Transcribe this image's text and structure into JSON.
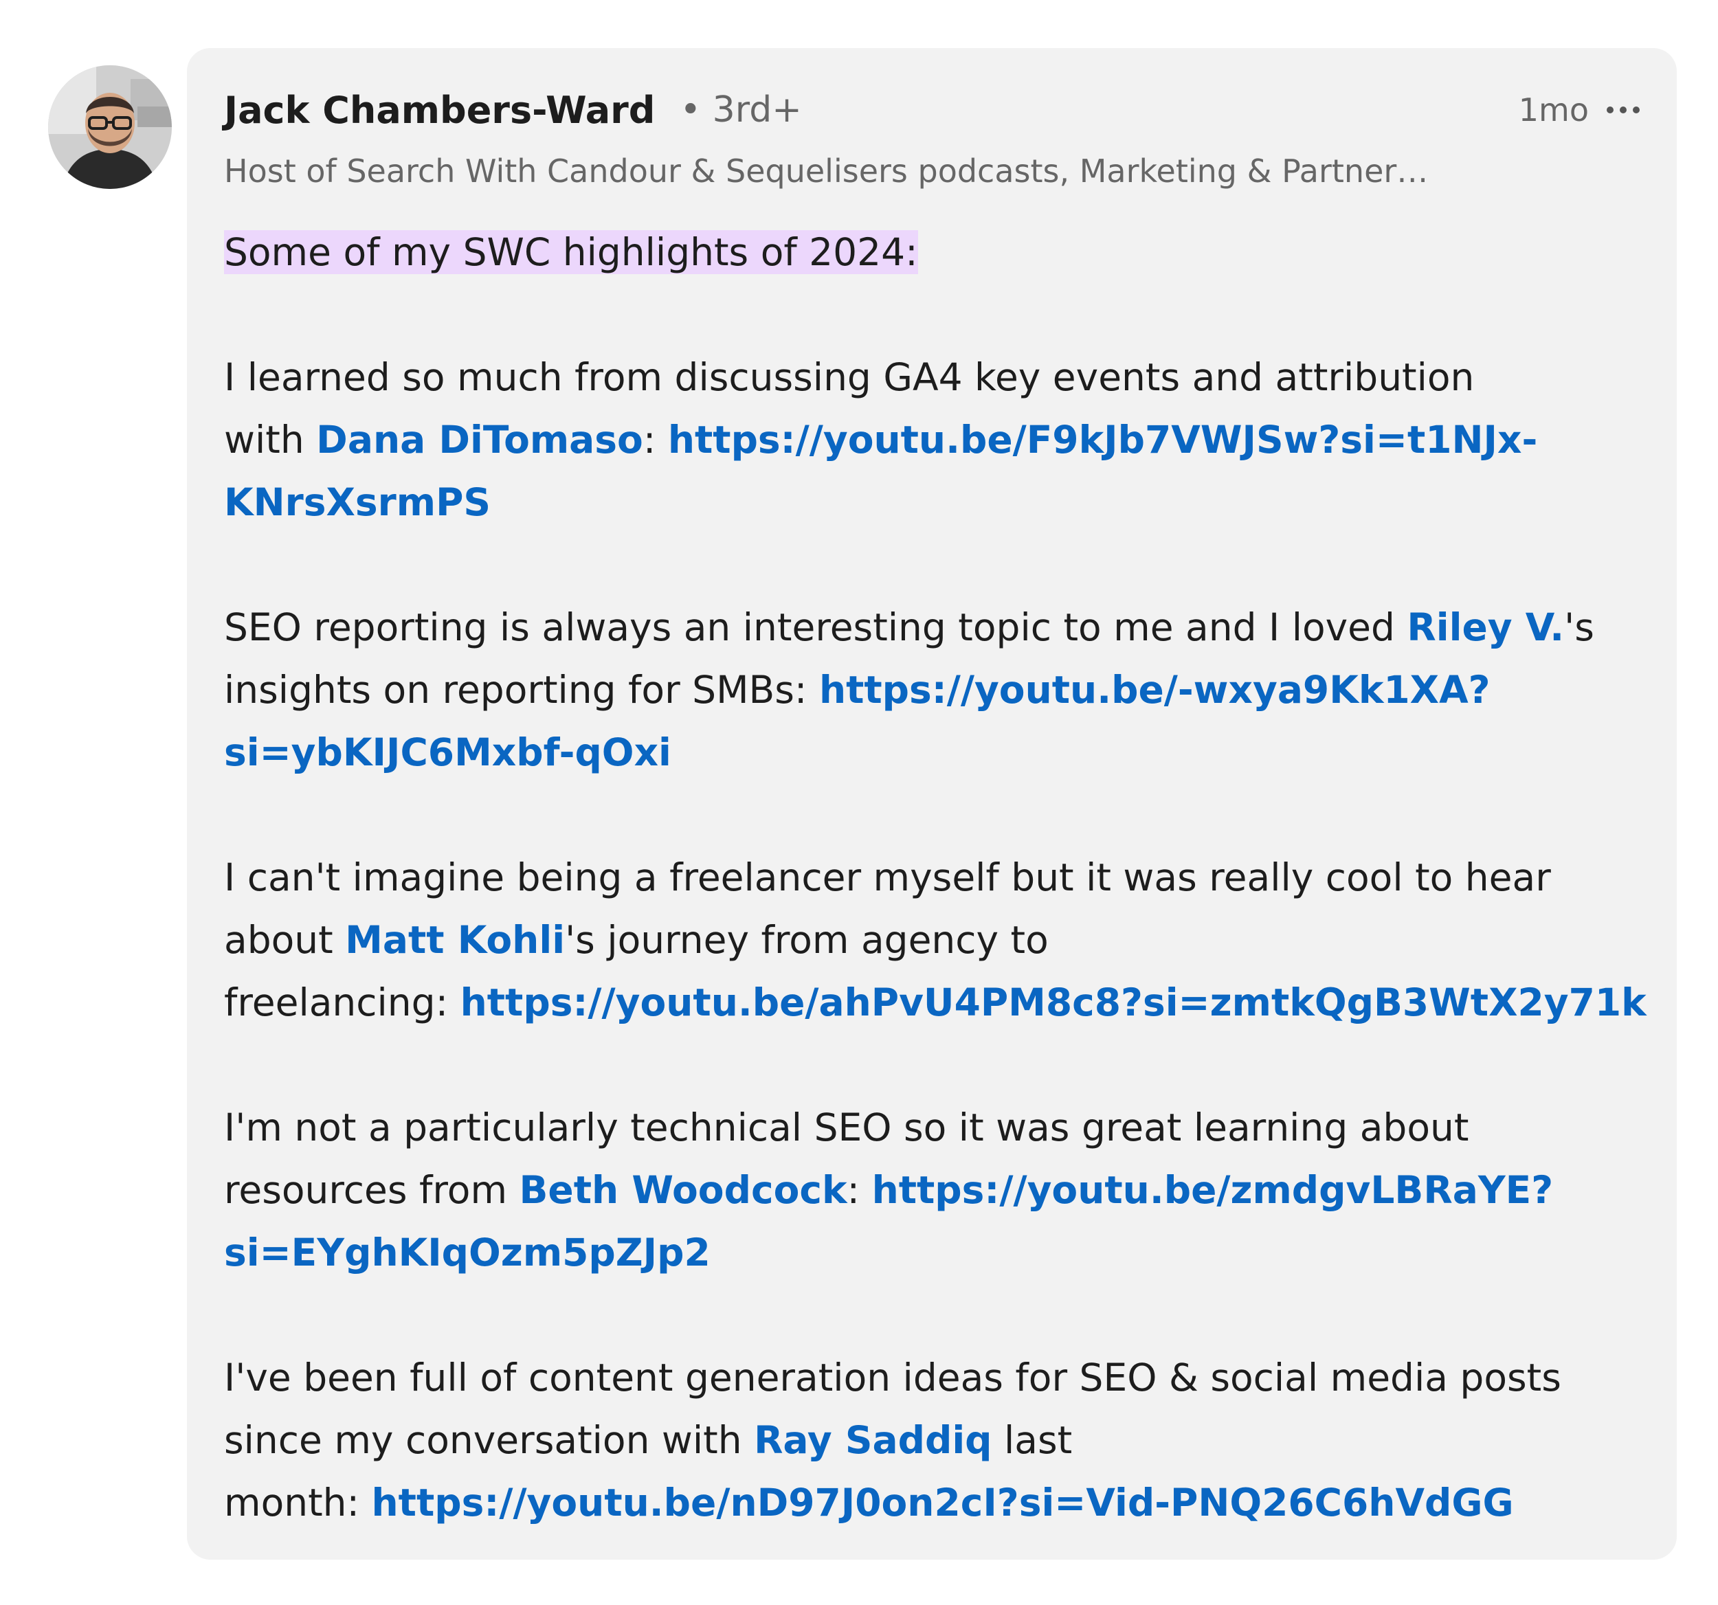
{
  "author": {
    "name": "Jack Chambers-Ward",
    "degree": "• 3rd+",
    "headline": "Host of Search With Candour & Sequelisers podcasts, Marketing & Partner…",
    "avatar_icon": "user-avatar-photo"
  },
  "post": {
    "timestamp": "1mo",
    "more_icon": "more-horizontal-icon",
    "highlight": "Some of my SWC highlights of 2024:",
    "para1": {
      "l1": "I learned so much from discussing GA4 key events and attribution",
      "l2_pre": "with ",
      "mention": "Dana DiTomaso",
      "l2_sep": ": ",
      "link_part1": "https://youtu.be/F9kJb7VWJSw?si=t1NJx-",
      "link_part2": "KNrsXsrmPS"
    },
    "para2": {
      "l1_pre": "SEO reporting is always an interesting topic to me and I loved ",
      "mention": "Riley V.",
      "l1_post": "'s",
      "l2_pre": "insights on reporting for SMBs: ",
      "link_part1": "https://youtu.be/-wxya9Kk1XA?",
      "link_part2": "si=ybKIJC6Mxbf-qOxi"
    },
    "para3": {
      "l1": "I can't imagine being a freelancer myself but it was really cool to hear",
      "l2_pre": "about ",
      "mention": "Matt Kohli",
      "l2_post": "'s journey from agency to",
      "l3_pre": "freelancing: ",
      "link": "https://youtu.be/ahPvU4PM8c8?si=zmtkQgB3WtX2y71k"
    },
    "para4": {
      "l1": "I'm not a particularly technical SEO so it was great learning about",
      "l2_pre": "resources from ",
      "mention": "Beth Woodcock",
      "l2_sep": ": ",
      "link_part1": "https://youtu.be/zmdgvLBRaYE?",
      "link_part2": "si=EYghKIqOzm5pZJp2"
    },
    "para5": {
      "l1": "I've been full of content generation ideas for SEO & social media posts",
      "l2_pre": "since my conversation with ",
      "mention": "Ray Saddiq",
      "l2_post": " last",
      "l3_pre": "month: ",
      "link": "https://youtu.be/nD97J0on2cI?si=Vid-PNQ26C6hVdGG"
    }
  },
  "colors": {
    "card_background": "#f2f2f2",
    "link": "#0a66c2",
    "highlight": "#ecd7fc",
    "text": "#1d1d1d",
    "muted": "#666666"
  }
}
